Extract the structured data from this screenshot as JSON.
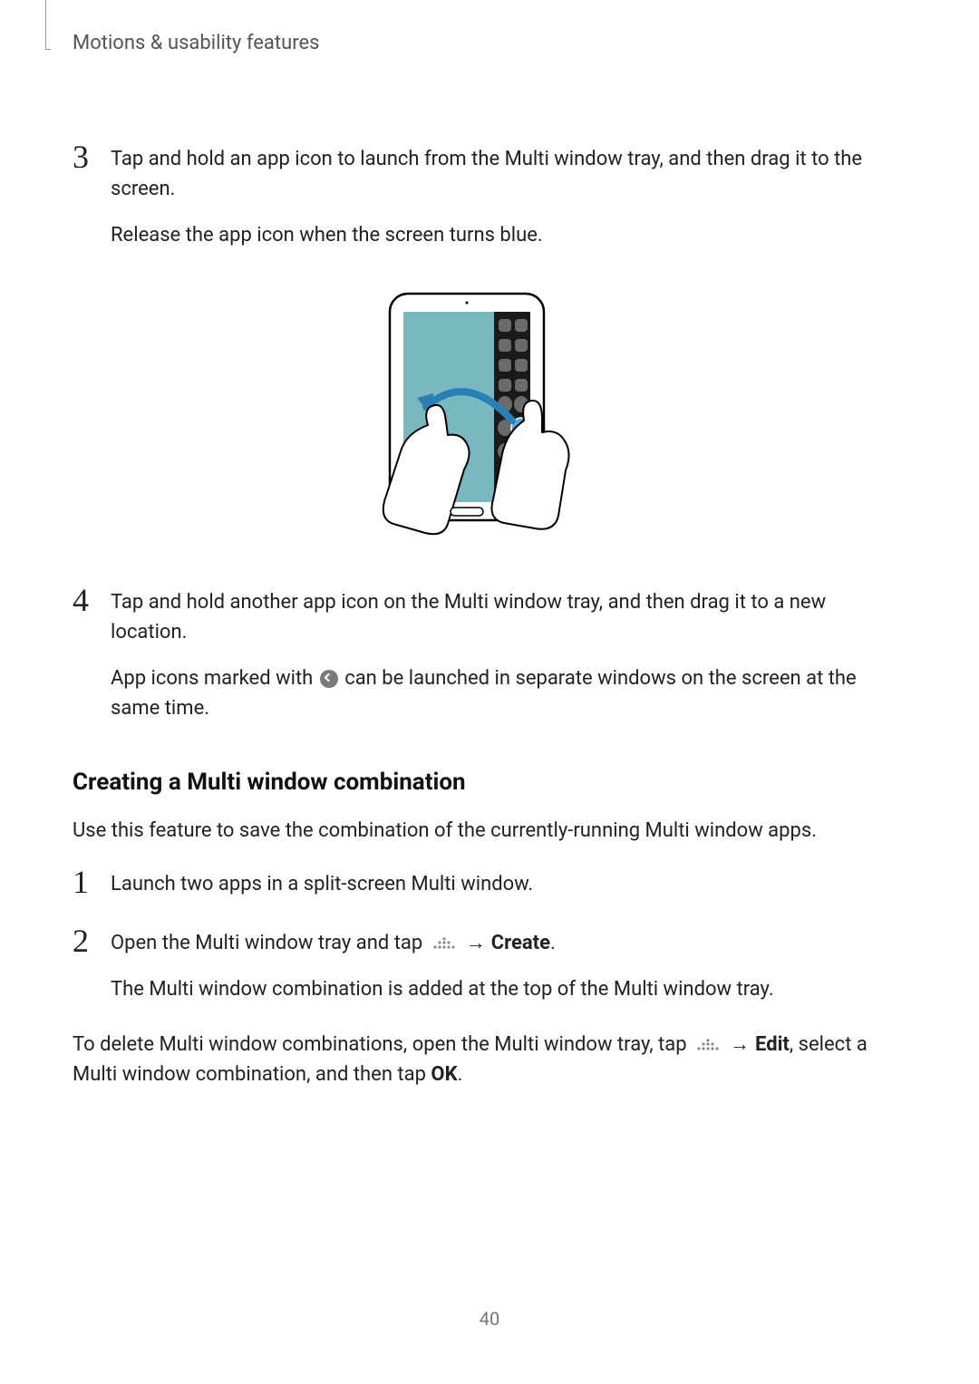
{
  "header": {
    "title": "Motions & usability features"
  },
  "steps_a": [
    {
      "num": "3",
      "para1": "Tap and hold an app icon to launch from the Multi window tray, and then drag it to the screen.",
      "para2": "Release the app icon when the screen turns blue."
    }
  ],
  "steps_b": [
    {
      "num": "4",
      "para1": "Tap and hold another app icon on the Multi window tray, and then drag it to a new location.",
      "para2_pre": "App icons marked with ",
      "para2_post": " can be launched in separate windows on the screen at the same time."
    }
  ],
  "section": {
    "heading": "Creating a Multi window combination",
    "intro": "Use this feature to save the combination of the currently-running Multi window apps."
  },
  "steps_c": [
    {
      "num": "1",
      "text": "Launch two apps in a split-screen Multi window."
    },
    {
      "num": "2",
      "text_pre": "Open the Multi window tray and tap ",
      "arrow": "→",
      "bold": "Create",
      "text_post": ".",
      "para2": "The Multi window combination is added at the top of the Multi window tray."
    }
  ],
  "footer_para": {
    "pre": "To delete Multi window combinations, open the Multi window tray, tap ",
    "arrow": "→",
    "bold": "Edit",
    "mid": ", select a Multi window combination, and then tap ",
    "bold2": "OK",
    "post": "."
  },
  "page_number": "40"
}
